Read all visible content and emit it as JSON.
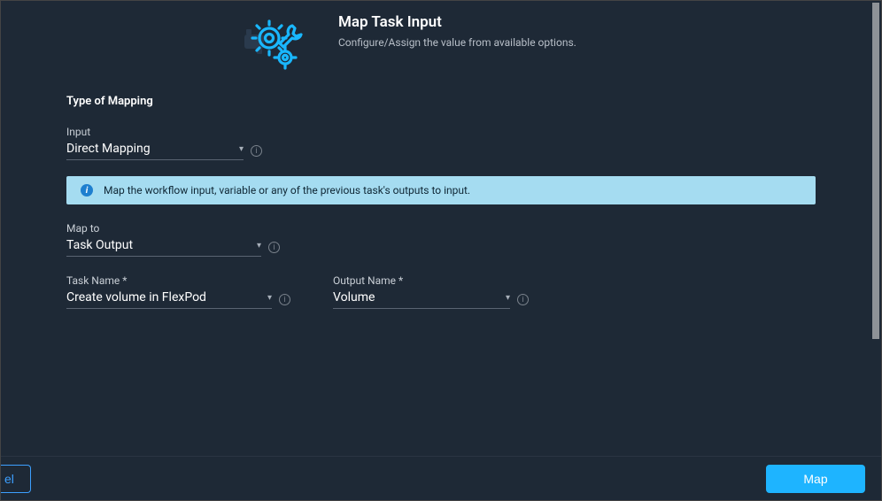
{
  "header": {
    "title": "Map Task Input",
    "subtitle": "Configure/Assign the value from available options."
  },
  "section": {
    "title": "Type of Mapping"
  },
  "fields": {
    "input": {
      "label": "Input",
      "value": "Direct Mapping"
    },
    "mapTo": {
      "label": "Map to",
      "value": "Task Output"
    },
    "taskName": {
      "label": "Task Name *",
      "value": "Create volume in FlexPod"
    },
    "outputName": {
      "label": "Output Name *",
      "value": "Volume"
    }
  },
  "banner": {
    "text": "Map the workflow input, variable or any of the previous task's outputs to input."
  },
  "footer": {
    "cancel": "el",
    "map": "Map"
  }
}
